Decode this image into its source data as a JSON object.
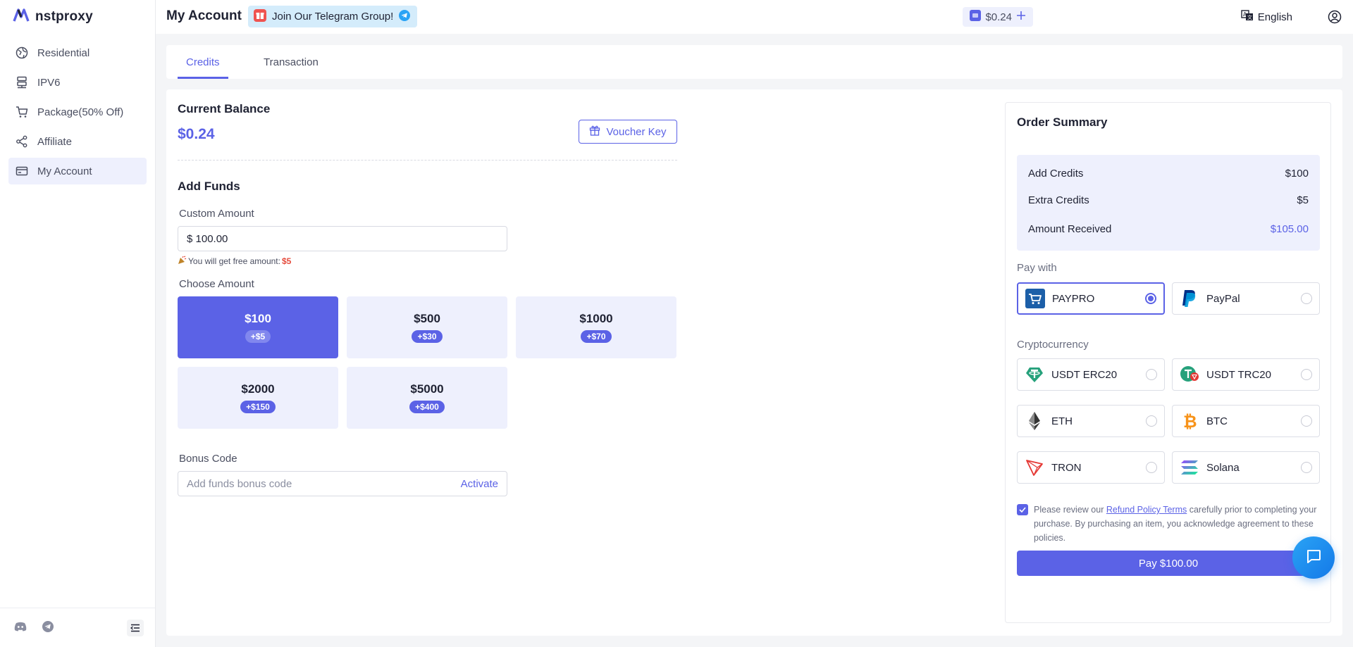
{
  "brand": {
    "name": "nstproxy"
  },
  "sidebar": {
    "items": [
      {
        "label": "Residential",
        "icon": "globe-icon",
        "active": false
      },
      {
        "label": "IPV6",
        "icon": "server-icon",
        "active": false
      },
      {
        "label": "Package(50% Off)",
        "icon": "cart-icon",
        "active": false
      },
      {
        "label": "Affiliate",
        "icon": "share-icon",
        "active": false
      },
      {
        "label": "My Account",
        "icon": "card-icon",
        "active": true
      }
    ],
    "bottom_icons": [
      "discord-icon",
      "telegram-icon",
      "collapse-menu-icon"
    ]
  },
  "header": {
    "title": "My Account",
    "telegram_banner": "Join Our Telegram Group!",
    "balance": "$0.24",
    "language": "English"
  },
  "tabs": [
    {
      "label": "Credits",
      "active": true
    },
    {
      "label": "Transaction",
      "active": false
    }
  ],
  "credits": {
    "current_balance_label": "Current Balance",
    "current_balance": "$0.24",
    "voucher_button": "Voucher Key",
    "add_funds_title": "Add Funds",
    "custom_amount_label": "Custom Amount",
    "custom_amount_value": "$ 100.00",
    "free_hint": "You will get free amount:",
    "free_amount": "$5",
    "choose_amount_label": "Choose Amount",
    "amounts": [
      {
        "amount": "$100",
        "bonus": "+$5",
        "selected": true
      },
      {
        "amount": "$500",
        "bonus": "+$30",
        "selected": false
      },
      {
        "amount": "$1000",
        "bonus": "+$70",
        "selected": false
      },
      {
        "amount": "$2000",
        "bonus": "+$150",
        "selected": false
      },
      {
        "amount": "$5000",
        "bonus": "+$400",
        "selected": false
      }
    ],
    "bonus_code_label": "Bonus Code",
    "bonus_code_placeholder": "Add funds bonus code",
    "activate_label": "Activate"
  },
  "order_summary": {
    "title": "Order Summary",
    "rows": [
      {
        "label": "Add Credits",
        "value": "$100"
      },
      {
        "label": "Extra Credits",
        "value": "$5"
      },
      {
        "label": "Amount Received",
        "value": "$105.00"
      }
    ],
    "pay_with_label": "Pay with",
    "pay_methods": [
      {
        "label": "PAYPRO",
        "icon": "paypro-cart-icon",
        "selected": true
      },
      {
        "label": "PayPal",
        "icon": "paypal-icon",
        "selected": false
      }
    ],
    "crypto_label": "Cryptocurrency",
    "crypto_methods": [
      {
        "label": "USDT ERC20",
        "icon": "tether-icon",
        "selected": false
      },
      {
        "label": "USDT TRC20",
        "icon": "tether-tron-icon",
        "selected": false
      },
      {
        "label": "ETH",
        "icon": "ethereum-icon",
        "selected": false
      },
      {
        "label": "BTC",
        "icon": "bitcoin-icon",
        "selected": false
      },
      {
        "label": "TRON",
        "icon": "tron-icon",
        "selected": false
      },
      {
        "label": "Solana",
        "icon": "solana-icon",
        "selected": false
      }
    ],
    "agree_prefix": "Please review our",
    "agree_link": "Refund Policy Terms",
    "agree_suffix": "carefully prior to completing your purchase. By purchasing an item, you acknowledge agreement to these policies.",
    "pay_button": "Pay $100.00"
  },
  "colors": {
    "accent": "#5b62e6",
    "accent_light": "#eef0fd",
    "hint_red": "#e54b3c",
    "chat_blue": "#1479e8"
  }
}
